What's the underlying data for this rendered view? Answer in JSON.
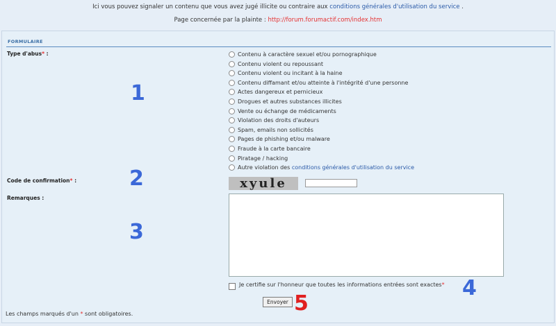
{
  "header": {
    "intro_text": "Ici vous pouvez signaler un contenu que vous avez jugé illicite ou contraire aux",
    "terms_link": "conditions générales d'utilisation du service",
    "intro_end": ".",
    "page_label": "Page concernée par la plainte :",
    "page_url": "http://forum.forumactif.com/index.htm"
  },
  "form": {
    "section_title": "FORMULAIRE",
    "abuse_type_label": "Type d'abus",
    "abuse_options": [
      "Contenu à caractère sexuel et/ou pornographique",
      "Contenu violent ou repoussant",
      "Contenu violent ou incitant à la haine",
      "Contenu diffamant et/ou atteinte à l'intégrité d'une personne",
      "Actes dangereux et pernicieux",
      "Drogues et autres substances illicites",
      "Vente ou échange de médicaments",
      "Violation des droits d'auteurs",
      "Spam, emails non sollicités",
      "Pages de phishing et/ou malware",
      "Fraude à la carte bancaire",
      "Piratage / hacking"
    ],
    "other_violation_prefix": "Autre violation des",
    "other_violation_link": "conditions générales d'utilisation du service",
    "confirmation_label": "Code de confirmation",
    "captcha_text": "xyule",
    "remarks_label": "Remarques :",
    "certify_text": "Je certifie sur l'honneur que toutes les informations entrées sont exactes",
    "submit_label": "Envoyer",
    "footnote_prefix": "Les champs marqués d'un",
    "footnote_star": "*",
    "footnote_suffix": "sont obligatoires.",
    "required_star": "*",
    "colon": ":"
  },
  "annotations": [
    "1",
    "2",
    "3",
    "4",
    "5"
  ],
  "colors": {
    "background": "#e6eef7",
    "link": "#2a5aa8",
    "url": "#e53030",
    "required": "#e53030",
    "annotation_blue": "#3b68d8",
    "annotation_red": "#e02020"
  }
}
